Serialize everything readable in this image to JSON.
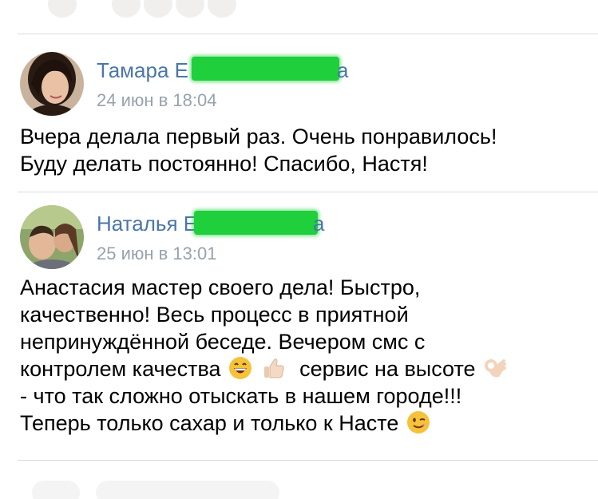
{
  "comments": [
    {
      "author_visible": "Тамара Е",
      "author_tail": "а",
      "date": "24 июн в 18:04",
      "text_lines": [
        "Вчера делала первый раз. Очень понравилось!",
        "Буду делать постоянно! Спасибо, Настя!"
      ]
    },
    {
      "author_visible": "Наталья Е",
      "author_tail": "а",
      "date": "25 июн в 13:01",
      "text_lines": [
        "Анастасия мастер своего дела! Быстро,",
        "качественно! Весь процесс в приятной",
        "непринуждённой беседе. Вечером смс с"
      ],
      "line4_before": "контролем качества",
      "line4_mid": "сервис на высоте",
      "line5": "- что так сложно отыскать в нашем городе!!!",
      "line6_before": "Теперь только сахар и только к Насте",
      "emojis": [
        "grinning-face-emoji",
        "thumbs-up-emoji",
        "ok-hand-emoji",
        "winking-face-emoji"
      ]
    }
  ],
  "colors": {
    "author": "#4a76a8",
    "date": "#98a2ad",
    "redaction": "#1fcf3c",
    "divider": "#d9dce0"
  }
}
